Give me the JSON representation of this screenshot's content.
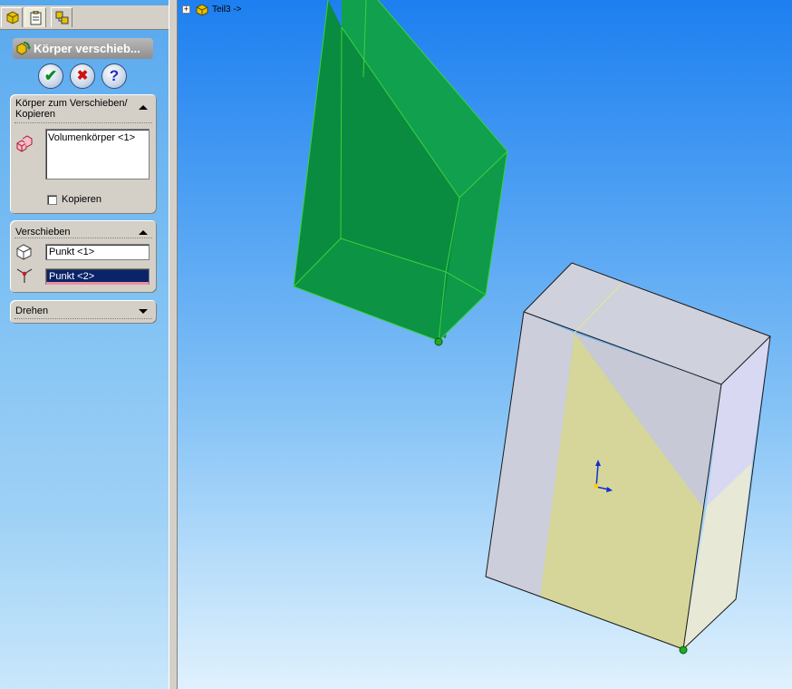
{
  "property_manager": {
    "title": "Körper verschieb...",
    "buttons": {
      "ok": "✔",
      "cancel": "✖",
      "help": "?"
    },
    "group_move_copy": {
      "heading_line1": "Körper zum Verschieben/",
      "heading_line2": "Kopieren",
      "selected_bodies": "Volumenkörper <1>",
      "copy_label": "Kopieren",
      "copy_checked": false
    },
    "group_translate": {
      "heading": "Verschieben",
      "point_1": "Punkt <1>",
      "point_2": "Punkt <2>"
    },
    "group_rotate": {
      "heading": "Drehen"
    }
  },
  "feature_tree": {
    "root_label": "Teil3 ->"
  },
  "colors": {
    "green_body": "#0a8c40",
    "green_edge": "#3cd23c",
    "grey_body": "#cfd1dc",
    "yellow_face": "#d6d69a",
    "selected_point": "#22aa22"
  }
}
